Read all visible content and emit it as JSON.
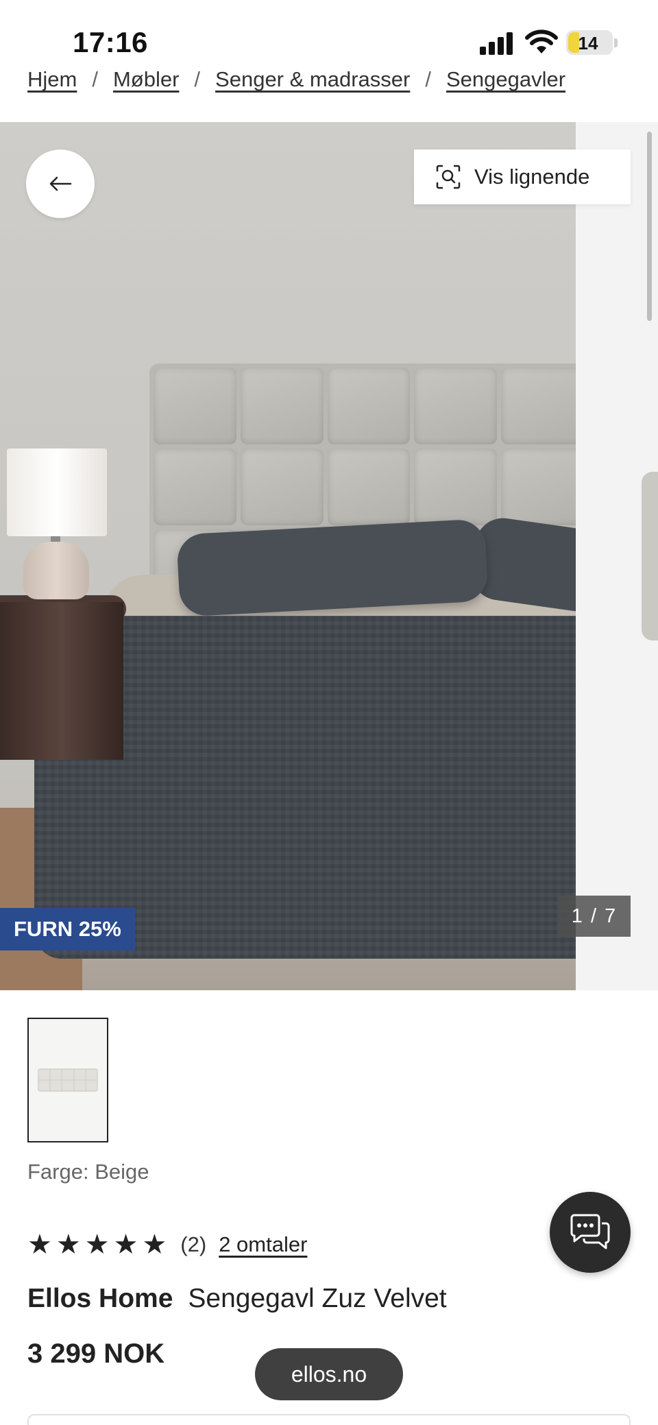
{
  "status_bar": {
    "time": "17:16",
    "battery_level": "14"
  },
  "breadcrumb": {
    "items": [
      "Hjem",
      "Møbler",
      "Senger & madrasser",
      "Sengegavler"
    ],
    "separator": "/"
  },
  "gallery": {
    "similar_label": "Vis lignende",
    "promo_badge": "FURN 25%",
    "counter": "1 / 7",
    "back_icon": "arrow-left-icon",
    "similar_icon": "visual-search-icon",
    "promo_color": "#2a4b8d"
  },
  "product": {
    "color_label": "Farge: Beige",
    "rating_stars": 5,
    "rating_count": "(2)",
    "reviews_link": "2 omtaler",
    "brand": "Ellos Home",
    "name": "Sengegavl Zuz Velvet",
    "price": "3 299 NOK"
  },
  "chat": {
    "icon": "chat-bubbles-icon"
  },
  "browser": {
    "url": "ellos.no"
  }
}
